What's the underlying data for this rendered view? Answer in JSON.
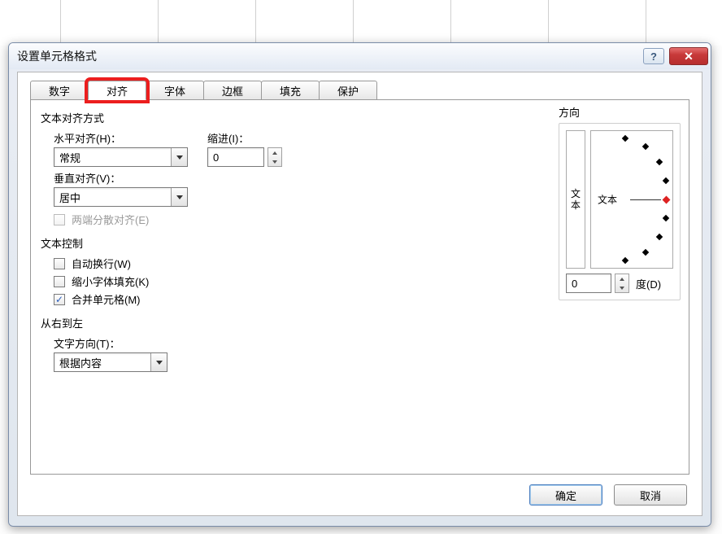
{
  "dialog": {
    "title": "设置单元格格式"
  },
  "tabs": {
    "number": "数字",
    "alignment": "对齐",
    "font": "字体",
    "border": "边框",
    "fill": "填充",
    "protect": "保护"
  },
  "align": {
    "section": "文本对齐方式",
    "h_label": "水平对齐(H)：",
    "h_value": "常规",
    "indent_label": "缩进(I)：",
    "indent_value": "0",
    "v_label": "垂直对齐(V)：",
    "v_value": "居中",
    "distributed": "两端分散对齐(E)"
  },
  "textctrl": {
    "section": "文本控制",
    "wrap": "自动换行(W)",
    "shrink": "缩小字体填充(K)",
    "merge": "合并单元格(M)"
  },
  "rtl": {
    "section": "从右到左",
    "dir_label": "文字方向(T)：",
    "dir_value": "根据内容"
  },
  "orient": {
    "section": "方向",
    "vert_text": "文本",
    "horiz_text": "文本",
    "deg_value": "0",
    "deg_label": "度(D)"
  },
  "buttons": {
    "ok": "确定",
    "cancel": "取消"
  }
}
